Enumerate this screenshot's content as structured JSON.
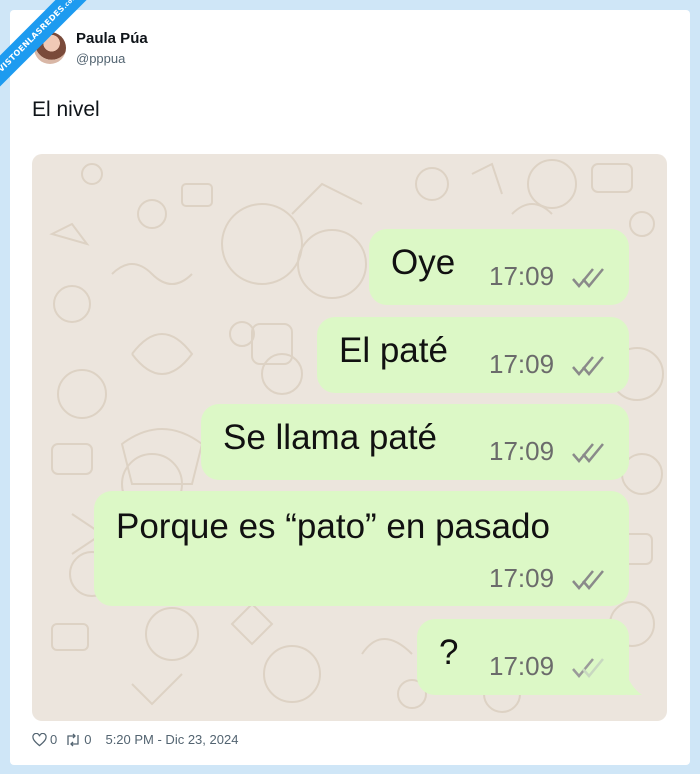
{
  "watermark": {
    "text": "VISTOENLASREDES",
    "suffix": ".com"
  },
  "author": {
    "name": "Paula Púa",
    "handle": "@pppua"
  },
  "tweet": {
    "text": "El nivel"
  },
  "chat": {
    "messages": [
      {
        "text": "Oye",
        "time": "17:09",
        "status": "read"
      },
      {
        "text": "El paté",
        "time": "17:09",
        "status": "read"
      },
      {
        "text": "Se llama paté",
        "time": "17:09",
        "status": "read"
      },
      {
        "text": "Porque es “pato” en pasado",
        "time": "17:09",
        "status": "read"
      },
      {
        "text": "?",
        "time": "17:09",
        "status": "delivered"
      }
    ],
    "bubble_color": "#dcf8c6",
    "wallpaper_color": "#ece5dd"
  },
  "footer": {
    "likes": "0",
    "retweets": "0",
    "timestamp": "5:20 PM - Dic 23, 2024"
  },
  "colors": {
    "accent": "#1d9bf0",
    "page_bg": "#cfe6f7"
  }
}
